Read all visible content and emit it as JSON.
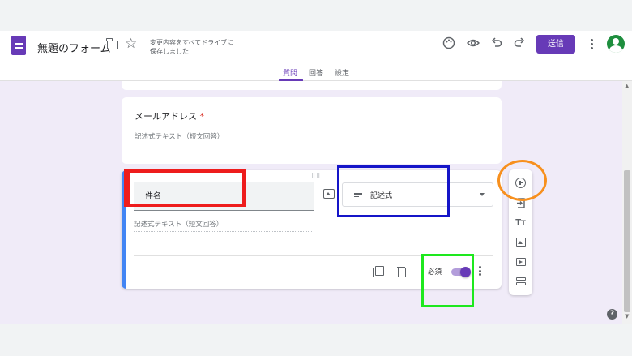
{
  "header": {
    "form_title": "無題のフォーム",
    "save_status": "変更内容をすべてドライブに保存しました",
    "send_label": "送信",
    "icons": [
      "forms-logo-icon",
      "folder-icon",
      "star-icon",
      "palette-icon",
      "preview-icon",
      "undo-icon",
      "redo-icon",
      "more-vert-icon",
      "avatar"
    ]
  },
  "tabs": [
    {
      "label": "質問",
      "active": true
    },
    {
      "label": "回答",
      "active": false
    },
    {
      "label": "設定",
      "active": false
    }
  ],
  "questions": {
    "email": {
      "title": "メールアドレス",
      "required_mark": "*",
      "placeholder": "記述式テキスト（短文回答）"
    },
    "active": {
      "title": "件名",
      "type": "記述式",
      "placeholder": "記述式テキスト（短文回答）",
      "required_label": "必須",
      "required": true
    }
  },
  "side_toolbar": {
    "icons": [
      "add-question-icon",
      "import-questions-icon",
      "add-title-icon",
      "add-image-icon",
      "add-video-icon",
      "add-section-icon"
    ],
    "title_glyph": "Tт"
  },
  "help": "?",
  "colors": {
    "accent": "#673ab7",
    "active_card_border": "#4285f4",
    "highlight_red": "#ee1c1c",
    "highlight_blue": "#1515c8",
    "highlight_green": "#1ee81e",
    "highlight_orange": "#f7901e"
  }
}
